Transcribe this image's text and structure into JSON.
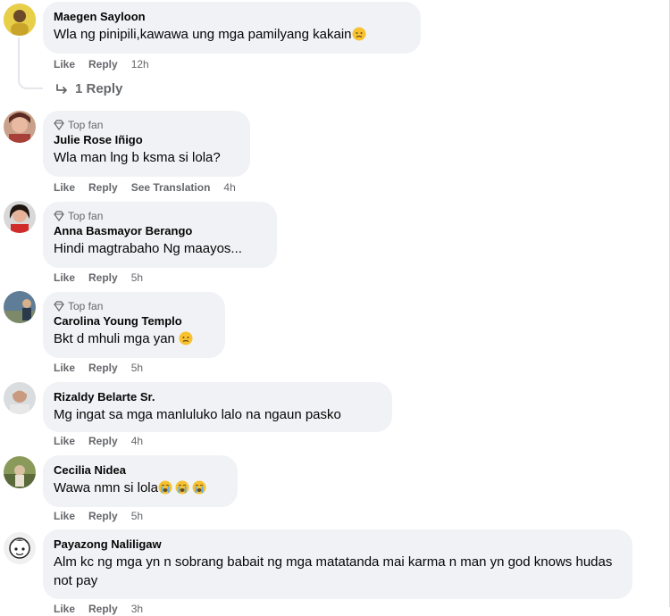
{
  "labels": {
    "like": "Like",
    "reply": "Reply",
    "see_translation": "See Translation",
    "top_fan": "Top fan"
  },
  "thread_reply": "1 Reply",
  "comments": [
    {
      "author": "Maegen Sayloon",
      "text": "Wla ng pinipili,kawawa ung mga pamilyang kakain",
      "time": "12h",
      "top_fan": false,
      "emoji": "sad-face",
      "avatar_color": "#e2c43c"
    },
    {
      "author": "Julie Rose Iñigo",
      "text": "Wla man lng b ksma si lola?",
      "time": "4h",
      "top_fan": true,
      "avatar_color": "#8a5a54"
    },
    {
      "author": "Anna Basmayor Berango",
      "text": "Hindi magtrabaho Ng maayos...",
      "time": "5h",
      "top_fan": true,
      "avatar_color": "#3a2a24"
    },
    {
      "author": "Carolina Young Templo",
      "text": "Bkt d mhuli mga yan",
      "time": "5h",
      "top_fan": true,
      "emoji": "sad-face",
      "avatar_color": "#4a6a86"
    },
    {
      "author": "Rizaldy Belarte Sr.",
      "text": "Mg ingat sa mga manluluko lalo na ngaun pasko",
      "time": "4h",
      "top_fan": false,
      "avatar_color": "#b8c0c6"
    },
    {
      "author": "Cecilia Nidea",
      "text": "Wawa nmn si lola",
      "time": "5h",
      "top_fan": false,
      "emoji": "crying-face x3",
      "avatar_color": "#7a8a4a"
    },
    {
      "author": "Payazong Naliligaw",
      "text": "Alm kc ng mga yn n sobrang babait ng mga matatanda mai karma n man yn god knows hudas not pay",
      "time": "3h",
      "top_fan": false,
      "avatar_color": "#f0f0f0"
    }
  ]
}
